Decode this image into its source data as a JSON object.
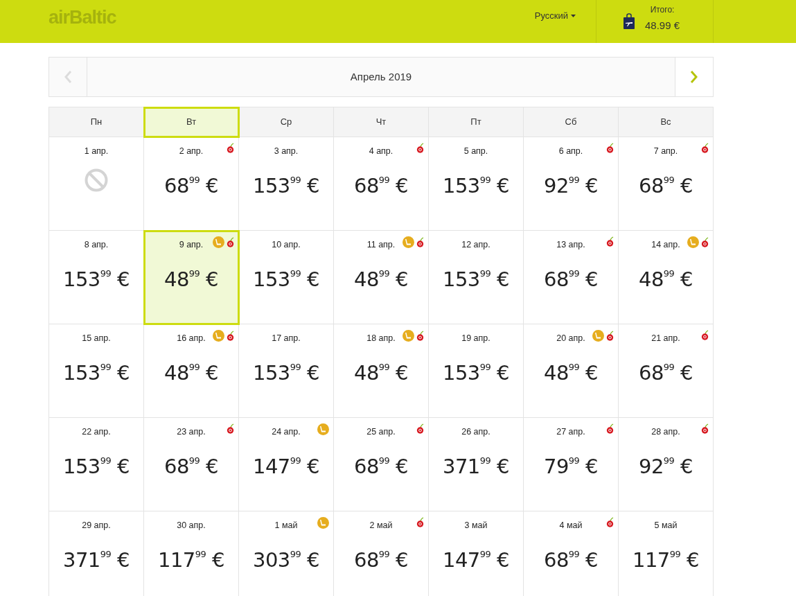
{
  "header": {
    "logo": "airBaltic",
    "language": "Русский",
    "total_label": "Итого:",
    "total_value": "48.99 €"
  },
  "month_nav": {
    "title": "Апрель 2019",
    "prev_disabled": true,
    "next_disabled": false
  },
  "weekdays": [
    {
      "label": "Пн",
      "selected": false
    },
    {
      "label": "Вт",
      "selected": true
    },
    {
      "label": "Ср",
      "selected": false
    },
    {
      "label": "Чт",
      "selected": false
    },
    {
      "label": "Пт",
      "selected": false
    },
    {
      "label": "Сб",
      "selected": false
    },
    {
      "label": "Вс",
      "selected": false
    }
  ],
  "days": [
    {
      "date": "1 апр.",
      "kind": "unavailable",
      "selected": false,
      "seat": false,
      "cherry": false
    },
    {
      "date": "2 апр.",
      "kind": "price",
      "price": "68$^{99}$ €",
      "selected": false,
      "seat": false,
      "cherry": true
    },
    {
      "date": "3 апр.",
      "kind": "price",
      "price": "153$^{99}$ €",
      "selected": false,
      "seat": false,
      "cherry": false
    },
    {
      "date": "4 апр.",
      "kind": "price",
      "price": "68$^{99}$ €",
      "selected": false,
      "seat": false,
      "cherry": true
    },
    {
      "date": "5 апр.",
      "kind": "price",
      "price": "153$^{99}$ €",
      "selected": false,
      "seat": false,
      "cherry": false
    },
    {
      "date": "6 апр.",
      "kind": "price",
      "price": "92$^{99}$ €",
      "selected": false,
      "seat": false,
      "cherry": true
    },
    {
      "date": "7 апр.",
      "kind": "price",
      "price": "68$^{99}$ €",
      "selected": false,
      "seat": false,
      "cherry": true
    },
    {
      "date": "8 апр.",
      "kind": "price",
      "price": "153$^{99}$ €",
      "selected": false,
      "seat": false,
      "cherry": false
    },
    {
      "date": "9 апр.",
      "kind": "price",
      "price": "48$^{99}$ €",
      "selected": true,
      "seat": true,
      "cherry": true
    },
    {
      "date": "10 апр.",
      "kind": "price",
      "price": "153$^{99}$ €",
      "selected": false,
      "seat": false,
      "cherry": false
    },
    {
      "date": "11 апр.",
      "kind": "price",
      "price": "48$^{99}$ €",
      "selected": false,
      "seat": true,
      "cherry": true
    },
    {
      "date": "12 апр.",
      "kind": "price",
      "price": "153$^{99}$ €",
      "selected": false,
      "seat": false,
      "cherry": false
    },
    {
      "date": "13 апр.",
      "kind": "price",
      "price": "68$^{99}$ €",
      "selected": false,
      "seat": false,
      "cherry": true
    },
    {
      "date": "14 апр.",
      "kind": "price",
      "price": "48$^{99}$ €",
      "selected": false,
      "seat": true,
      "cherry": true
    },
    {
      "date": "15 апр.",
      "kind": "price",
      "price": "153$^{99}$ €",
      "selected": false,
      "seat": false,
      "cherry": false
    },
    {
      "date": "16 апр.",
      "kind": "price",
      "price": "48$^{99}$ €",
      "selected": false,
      "seat": true,
      "cherry": true
    },
    {
      "date": "17 апр.",
      "kind": "price",
      "price": "153$^{99}$ €",
      "selected": false,
      "seat": false,
      "cherry": false
    },
    {
      "date": "18 апр.",
      "kind": "price",
      "price": "48$^{99}$ €",
      "selected": false,
      "seat": true,
      "cherry": true
    },
    {
      "date": "19 апр.",
      "kind": "price",
      "price": "153$^{99}$ €",
      "selected": false,
      "seat": false,
      "cherry": false
    },
    {
      "date": "20 апр.",
      "kind": "price",
      "price": "48$^{99}$ €",
      "selected": false,
      "seat": true,
      "cherry": true
    },
    {
      "date": "21 апр.",
      "kind": "price",
      "price": "68$^{99}$ €",
      "selected": false,
      "seat": false,
      "cherry": true
    },
    {
      "date": "22 апр.",
      "kind": "price",
      "price": "153$^{99}$ €",
      "selected": false,
      "seat": false,
      "cherry": false
    },
    {
      "date": "23 апр.",
      "kind": "price",
      "price": "68$^{99}$ €",
      "selected": false,
      "seat": false,
      "cherry": true
    },
    {
      "date": "24 апр.",
      "kind": "price",
      "price": "147$^{99}$ €",
      "selected": false,
      "seat": true,
      "cherry": false
    },
    {
      "date": "25 апр.",
      "kind": "price",
      "price": "68$^{99}$ €",
      "selected": false,
      "seat": false,
      "cherry": true
    },
    {
      "date": "26 апр.",
      "kind": "price",
      "price": "371$^{99}$ €",
      "selected": false,
      "seat": false,
      "cherry": false
    },
    {
      "date": "27 апр.",
      "kind": "price",
      "price": "79$^{99}$ €",
      "selected": false,
      "seat": false,
      "cherry": true
    },
    {
      "date": "28 апр.",
      "kind": "price",
      "price": "92$^{99}$ €",
      "selected": false,
      "seat": false,
      "cherry": true
    },
    {
      "date": "29 апр.",
      "kind": "price",
      "price": "371$^{99}$ €",
      "selected": false,
      "seat": false,
      "cherry": false
    },
    {
      "date": "30 апр.",
      "kind": "price",
      "price": "117$^{99}$ €",
      "selected": false,
      "seat": false,
      "cherry": false
    },
    {
      "date": "1 май",
      "kind": "price",
      "price": "303$^{99}$ €",
      "selected": false,
      "seat": true,
      "cherry": false
    },
    {
      "date": "2 май",
      "kind": "price",
      "price": "68$^{99}$ €",
      "selected": false,
      "seat": false,
      "cherry": true
    },
    {
      "date": "3 май",
      "kind": "price",
      "price": "147$^{99}$ €",
      "selected": false,
      "seat": false,
      "cherry": false
    },
    {
      "date": "4 май",
      "kind": "price",
      "price": "68$^{99}$ €",
      "selected": false,
      "seat": false,
      "cherry": true
    },
    {
      "date": "5 май",
      "kind": "price",
      "price": "117$^{99}$ €",
      "selected": false,
      "seat": false,
      "cherry": false
    }
  ]
}
